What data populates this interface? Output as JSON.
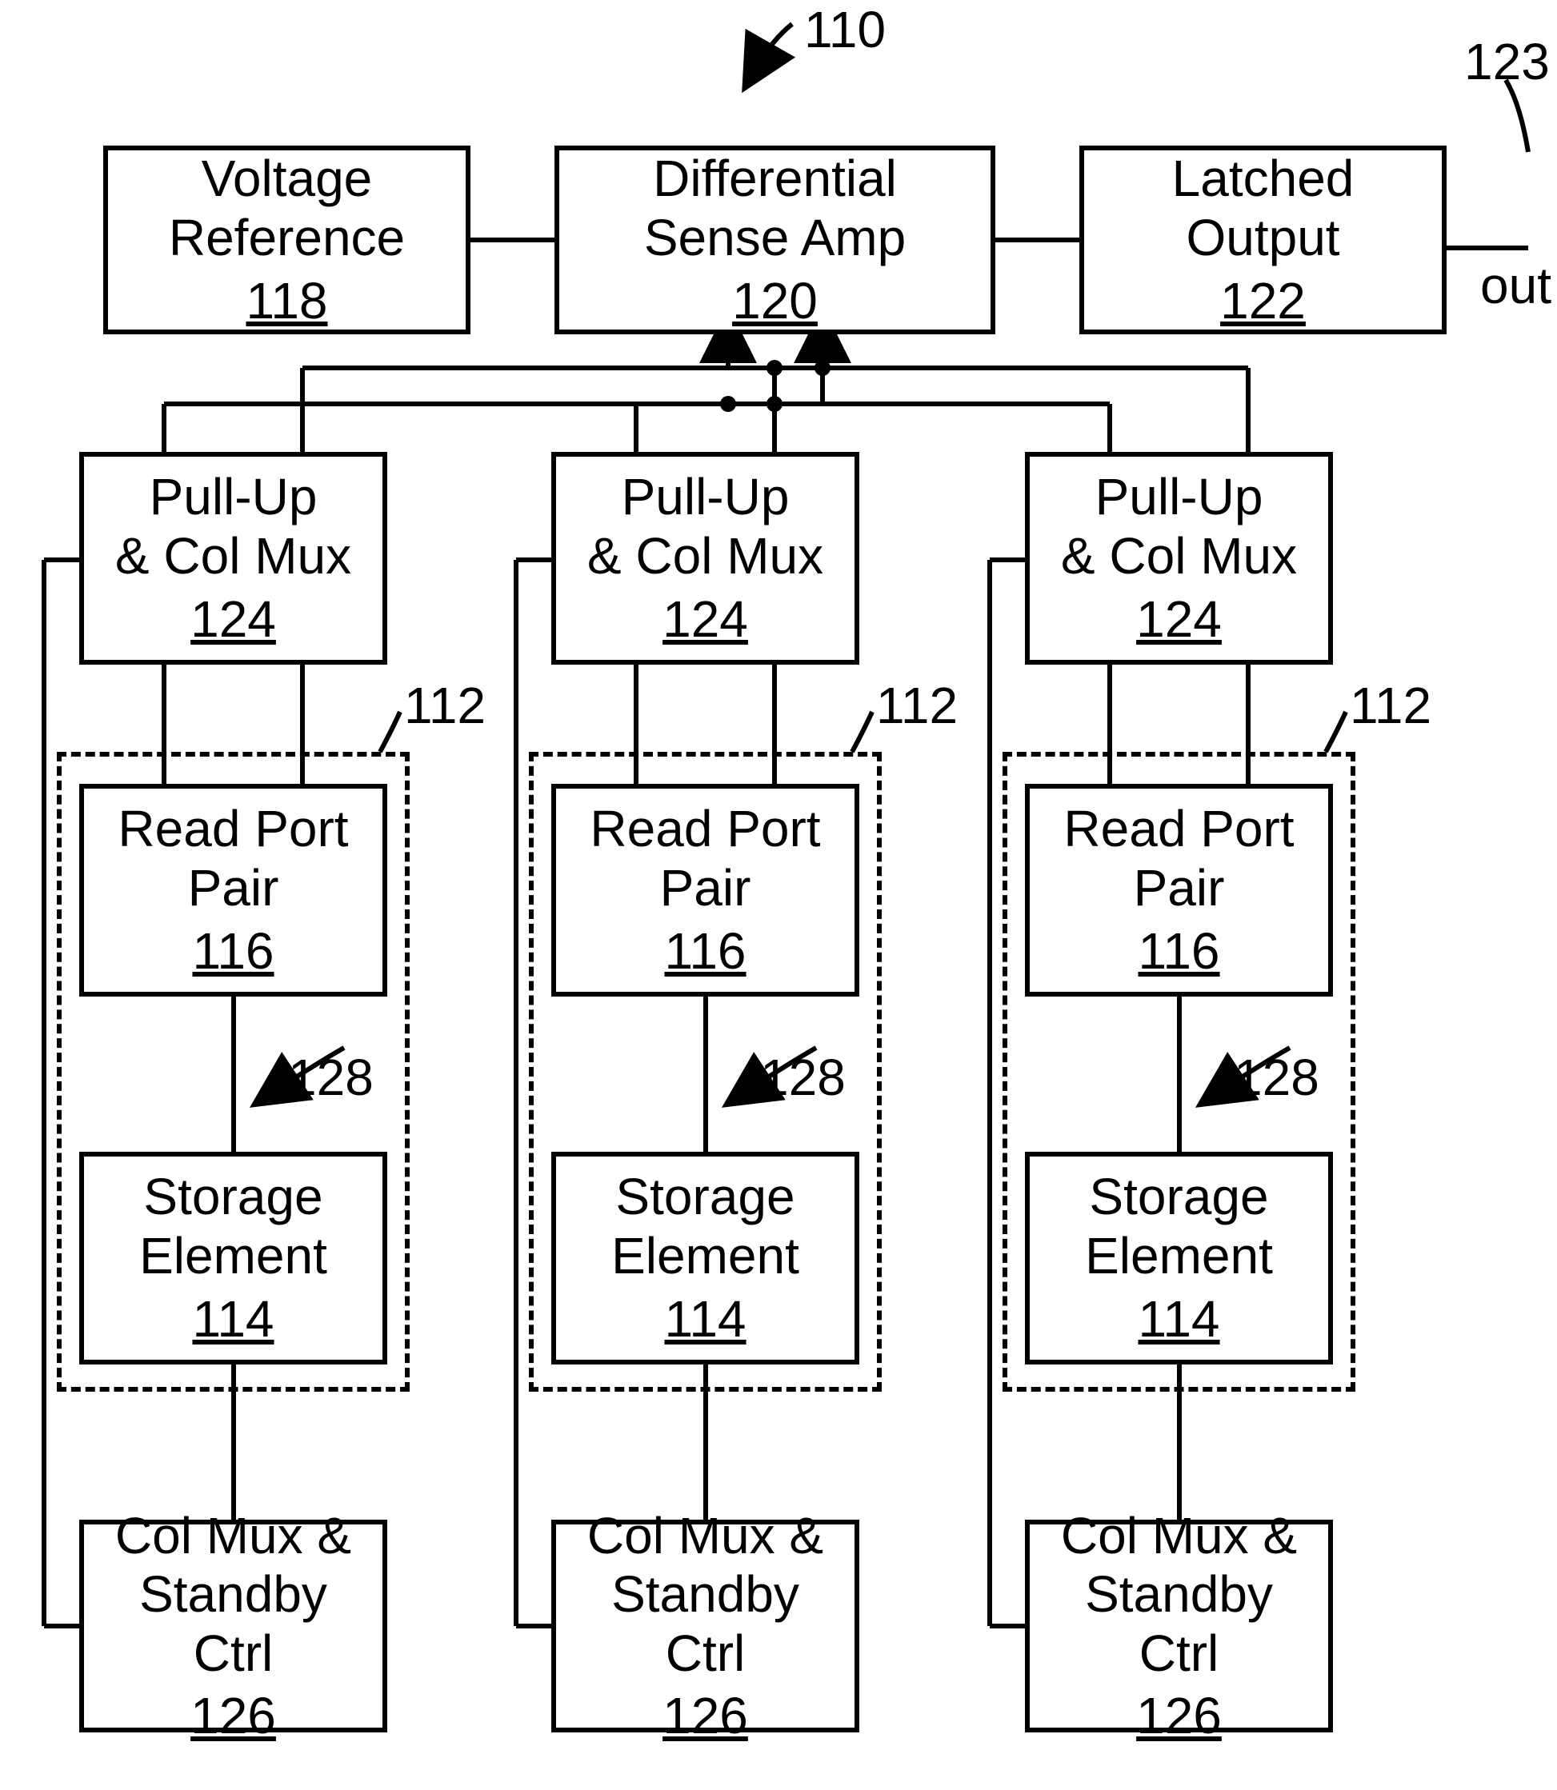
{
  "refs": {
    "diagram": "110",
    "output_line": "123",
    "cell_group": "112",
    "inner_arrow": "128"
  },
  "output_text": "out",
  "blocks": {
    "voltage_ref": {
      "title": "Voltage\nReference",
      "num": "118"
    },
    "sense_amp": {
      "title": "Differential\nSense Amp",
      "num": "120"
    },
    "latched_output": {
      "title": "Latched\nOutput",
      "num": "122"
    },
    "pullup": {
      "title": "Pull-Up\n& Col Mux",
      "num": "124"
    },
    "read_port": {
      "title": "Read Port\nPair",
      "num": "116"
    },
    "storage": {
      "title": "Storage Element",
      "num": "114"
    },
    "col_standby": {
      "title": "Col Mux &\nStandby Ctrl",
      "num": "126"
    }
  }
}
